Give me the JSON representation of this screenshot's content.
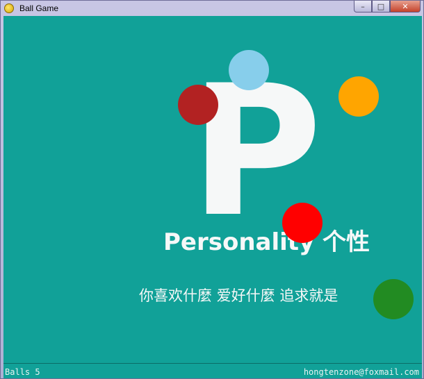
{
  "window": {
    "title": "Ball Game"
  },
  "banner": {
    "letter": "P",
    "headline": "Personality 个性",
    "tagline": "你喜欢什麼   爱好什麼   追求就是"
  },
  "balls": [
    {
      "name": "sky-blue",
      "color": "#87ceeb"
    },
    {
      "name": "dark-red",
      "color": "#b22222"
    },
    {
      "name": "orange",
      "color": "#ffa500"
    },
    {
      "name": "red",
      "color": "#ff0000"
    },
    {
      "name": "green",
      "color": "#228b22"
    }
  ],
  "status": {
    "balls_label": "Balls 5",
    "email": "hongtenzone@foxmail.com"
  },
  "colors": {
    "background": "#11a198",
    "letter": "#f6f8f8"
  }
}
